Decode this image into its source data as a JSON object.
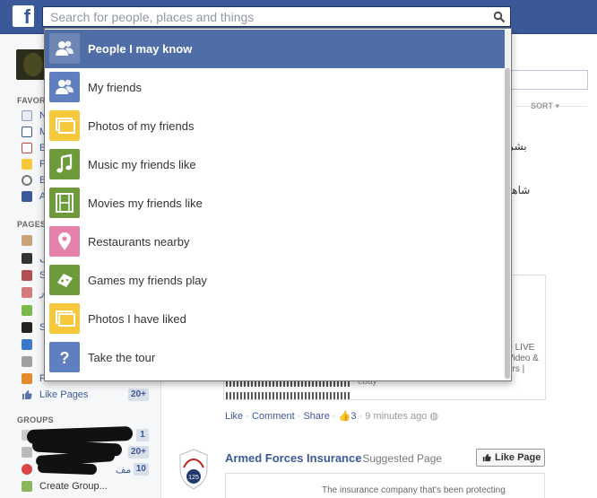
{
  "search": {
    "placeholder": "Search for people, places and things"
  },
  "dropdown": {
    "items": [
      {
        "label": "People I may know",
        "icon": "people-icon",
        "color": "#6e86b5"
      },
      {
        "label": "My friends",
        "icon": "people-icon",
        "color": "#5f7fc0"
      },
      {
        "label": "Photos of my friends",
        "icon": "photos-icon",
        "color": "#f6c93c"
      },
      {
        "label": "Music my friends like",
        "icon": "music-icon",
        "color": "#6e9a3c"
      },
      {
        "label": "Movies my friends like",
        "icon": "film-icon",
        "color": "#6e9a3c"
      },
      {
        "label": "Restaurants nearby",
        "icon": "map-pin-icon",
        "color": "#e581a8"
      },
      {
        "label": "Games my friends play",
        "icon": "gamepad-icon",
        "color": "#6e9a3c"
      },
      {
        "label": "Photos I have liked",
        "icon": "photos-icon",
        "color": "#f6c93c"
      },
      {
        "label": "Take the tour",
        "icon": "question-icon",
        "color": "#5f7fc0"
      }
    ]
  },
  "sidebar": {
    "favorites_label": "FAVORI",
    "favorites": [
      {
        "label": "N"
      },
      {
        "label": "M"
      },
      {
        "label": "E"
      },
      {
        "label": "P"
      },
      {
        "label": "B"
      },
      {
        "label": "A"
      }
    ],
    "pages_label": "PAGES",
    "pages": [
      {
        "label": ""
      },
      {
        "label": "ف"
      },
      {
        "label": "S"
      },
      {
        "label": "ر"
      },
      {
        "label": ""
      },
      {
        "label": "S"
      },
      {
        "label": ""
      },
      {
        "label": ""
      },
      {
        "label": "P"
      }
    ],
    "like_pages": {
      "label": "Like Pages",
      "count": "20+"
    },
    "groups_label": "GROUPS",
    "groups": [
      {
        "label": "",
        "count": "1"
      },
      {
        "label": "",
        "count": "20+"
      },
      {
        "label": "مف",
        "count": "10"
      }
    ],
    "create_group": "Create Group..."
  },
  "feed": {
    "sort_label": "SORT",
    "arabic_1": "بشر",
    "arabic_2": "شاهد",
    "card_text": "+ LIVE Video & ers |",
    "ebay": "ebay",
    "actions": {
      "like": "Like",
      "comment": "Comment",
      "share": "Share",
      "likes_count": "3",
      "time": "9 minutes ago"
    },
    "ad": {
      "title": "Armed Forces Insurance",
      "subtitle": "· Suggested Page",
      "like_button": "Like Page",
      "description": "The insurance company that's been protecting"
    }
  }
}
